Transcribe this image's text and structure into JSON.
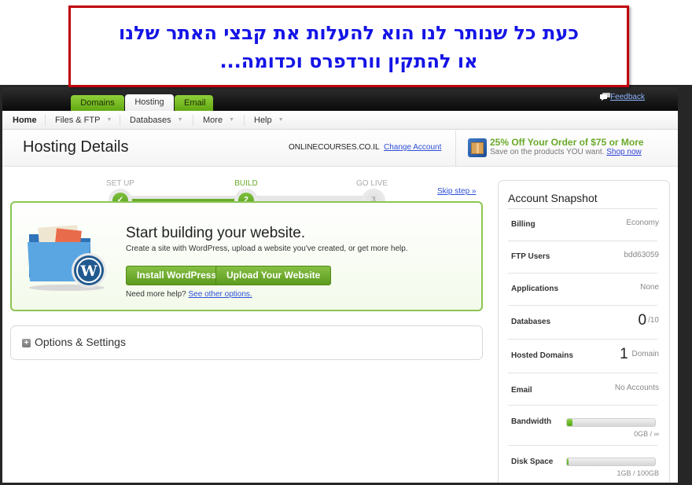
{
  "caption": {
    "line1": "כעת כל שנותר לנו הוא להעלות את קבצי האתר שלנו",
    "line2": "או להתקין וורדפרס וכדומה..."
  },
  "topbar": {
    "tabs": [
      {
        "label": "Domains",
        "active": false
      },
      {
        "label": "Hosting",
        "active": true
      },
      {
        "label": "Email",
        "active": false
      }
    ],
    "feedback_label": "Feedback"
  },
  "nav": {
    "items": [
      {
        "label": "Home",
        "dropdown": false
      },
      {
        "label": "Files & FTP",
        "dropdown": true
      },
      {
        "label": "Databases",
        "dropdown": true
      },
      {
        "label": "More",
        "dropdown": true
      },
      {
        "label": "Help",
        "dropdown": true
      }
    ]
  },
  "header": {
    "title": "Hosting Details",
    "account_domain": "ONLINECOURSES.CO.IL",
    "change_account_label": "Change Account",
    "promo_title": "25% Off Your Order of $75 or More",
    "promo_subtitle": "Save on the products YOU want.",
    "promo_link": "Shop now"
  },
  "steps": {
    "items": [
      {
        "label": "SET UP",
        "marker": "✓",
        "state": "done"
      },
      {
        "label": "BUILD",
        "marker": "2",
        "state": "current"
      },
      {
        "label": "GO LIVE",
        "marker": "3",
        "state": "todo"
      }
    ],
    "skip_label": "Skip step »"
  },
  "build": {
    "title": "Start building your website.",
    "description": "Create a site with WordPress, upload a website you've created, or get more help.",
    "install_button": "Install WordPress",
    "upload_button": "Upload Your Website",
    "help_text": "Need more help?",
    "help_link": "See other options."
  },
  "options": {
    "label": "Options & Settings"
  },
  "snapshot": {
    "title": "Account Snapshot",
    "billing": {
      "label": "Billing",
      "value": "Economy"
    },
    "ftp_users": {
      "label": "FTP Users",
      "value": "bdd63059"
    },
    "applications": {
      "label": "Applications",
      "value": "None"
    },
    "databases": {
      "label": "Databases",
      "count": "0",
      "suffix": "/10"
    },
    "hosted_domains": {
      "label": "Hosted Domains",
      "count": "1",
      "suffix": "Domain"
    },
    "email": {
      "label": "Email",
      "value": "No Accounts"
    },
    "bandwidth": {
      "label": "Bandwidth",
      "caption": "0GB / ∞",
      "usage_fraction": 0.0
    },
    "disk_space": {
      "label": "Disk Space",
      "caption": "1GB / 100GB",
      "usage_fraction": 0.01
    }
  }
}
